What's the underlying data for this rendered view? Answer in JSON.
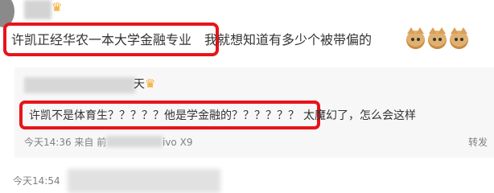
{
  "comment": {
    "text_highlighted": "许凯正经华农一本大学金融专业",
    "text_rest": "我就想知道有多少个被带偏的",
    "crown_glyph": "♛",
    "emoji_count": 3,
    "emoji_icon": "doge-cat-icon"
  },
  "reply": {
    "username_visible_end": "天",
    "crown_glyph": "♛",
    "text_highlighted": "许凯不是体育生？？？？？他是学金融的？？？？？？",
    "text_rest": "太魔幻了，怎么会这样",
    "time_prefix": "今天14:36 来自 前",
    "device_suffix": "ivo X9",
    "forward_label": "转发"
  },
  "bottom": {
    "time": "今天14:54"
  },
  "colors": {
    "highlight": "#e8131a",
    "reply_bg": "#f7f7f7",
    "meta_text": "#808080",
    "crown": "#f5a623"
  }
}
